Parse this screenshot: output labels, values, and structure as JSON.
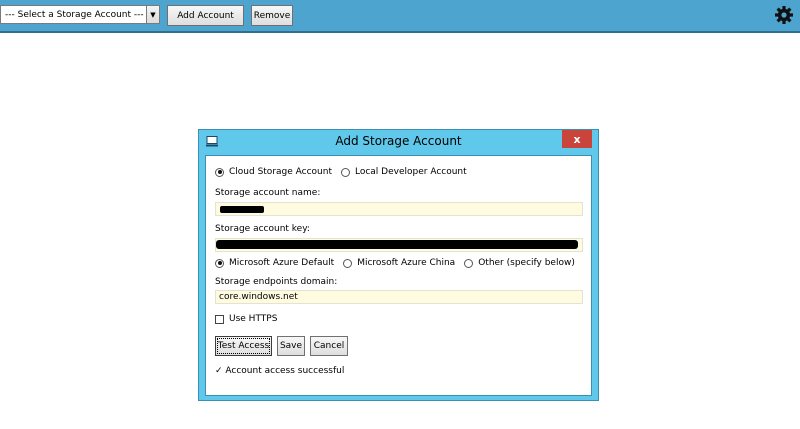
{
  "toolbar": {
    "account_select": {
      "value": "--- Select a Storage Account ---"
    },
    "add_account_label": "Add Account",
    "remove_label": "Remove",
    "accent_color": "#4ca4cf"
  },
  "dialog": {
    "title": "Add Storage Account",
    "close_glyph": "x",
    "account_type_options": [
      {
        "label": "Cloud Storage Account",
        "selected": true
      },
      {
        "label": "Local Developer Account",
        "selected": false
      }
    ],
    "name_label": "Storage account name:",
    "name_value": "",
    "key_label": "Storage account key:",
    "key_value": "",
    "environment_options": [
      {
        "label": "Microsoft Azure Default",
        "selected": true
      },
      {
        "label": "Microsoft Azure China",
        "selected": false
      },
      {
        "label": "Other (specify below)",
        "selected": false
      }
    ],
    "endpoints_label": "Storage endpoints domain:",
    "endpoints_value": "core.windows.net",
    "https_label": "Use HTTPS",
    "https_checked": false,
    "test_access_label": "Test Access",
    "save_label": "Save",
    "cancel_label": "Cancel",
    "status_text": "✓ Account access successful"
  }
}
